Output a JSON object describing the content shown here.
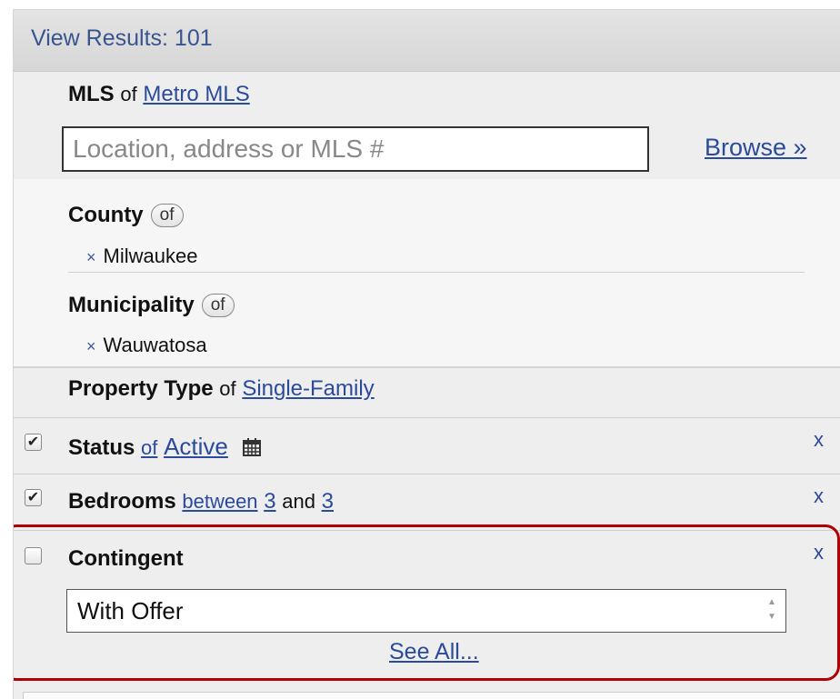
{
  "header": {
    "view_results_label": "View Results: 101"
  },
  "mls": {
    "label": "MLS",
    "of": "of",
    "value": "Metro MLS"
  },
  "search": {
    "placeholder": "Location, address or MLS #",
    "browse_label": "Browse »"
  },
  "geo": {
    "county": {
      "label": "County",
      "pill": "of",
      "items": [
        "Milwaukee"
      ]
    },
    "municipality": {
      "label": "Municipality",
      "pill": "of",
      "items": [
        "Wauwatosa"
      ]
    },
    "remove_glyph": "×"
  },
  "property_type": {
    "label": "Property Type",
    "of": "of",
    "value": "Single-Family"
  },
  "filters": {
    "status": {
      "checked": true,
      "label": "Status",
      "of": "of",
      "value": "Active",
      "remove": "x"
    },
    "bedrooms": {
      "checked": true,
      "label": "Bedrooms",
      "between": "between",
      "min": "3",
      "and": "and",
      "max": "3",
      "remove": "x"
    },
    "contingent": {
      "checked": false,
      "label": "Contingent",
      "selected_value": "With Offer",
      "see_all": "See All...",
      "remove": "x"
    }
  },
  "icons": {
    "checkmark": "✔",
    "spinner_up": "▲",
    "spinner_down": "▼"
  },
  "colors": {
    "link": "#2a4b9b",
    "highlight": "#b00000",
    "header_text": "#39558f"
  }
}
